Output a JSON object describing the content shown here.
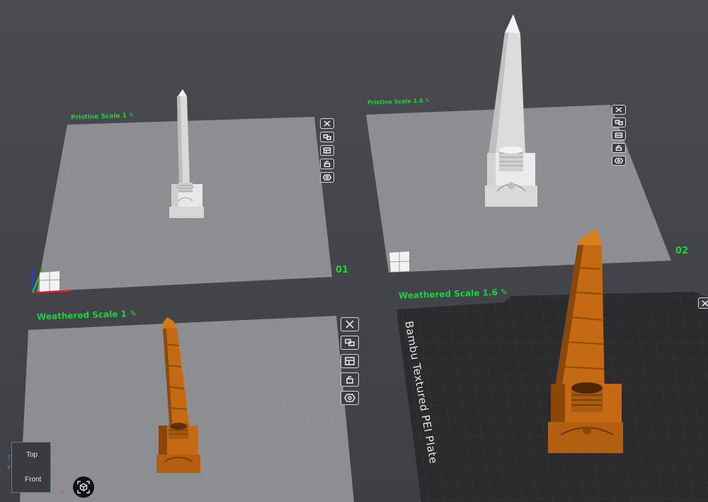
{
  "plates": [
    {
      "name": "Pristine Scale 1",
      "number": "01"
    },
    {
      "name": "Pristine Scale 1.6",
      "number": "02"
    },
    {
      "name": "Weathered Scale 1",
      "number": ""
    },
    {
      "name": "Weathered Scale 1.6",
      "number": ""
    }
  ],
  "plate4_surface_label": "Bambu Textured PEI Plate",
  "view_cube": {
    "top": "Top",
    "front": "Front"
  },
  "axes": {
    "z": "Z",
    "y": "Y",
    "x": "X"
  },
  "icons": {
    "edit": "pencil-icon",
    "tools": [
      "close-icon",
      "arrange-icon",
      "orient-icon",
      "lock-icon",
      "settings-icon"
    ],
    "recenter": "recenter-view-icon"
  },
  "colors": {
    "accent": "#1fd23b",
    "pristine_model": "#e6e6e6",
    "weathered_model": "#c36a13",
    "plate_light": "#8c8d91",
    "plate_dark": "#2b2b2e"
  }
}
